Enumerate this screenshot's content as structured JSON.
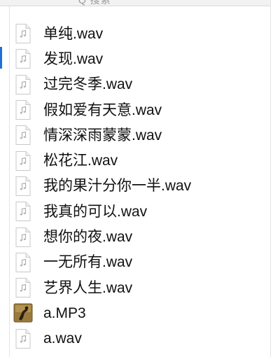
{
  "search": {
    "hint": "Q 搜索"
  },
  "files": [
    {
      "name": "单纯.wav",
      "icon": "audio-file-icon"
    },
    {
      "name": "发现.wav",
      "icon": "audio-file-icon"
    },
    {
      "name": "过完冬季.wav",
      "icon": "audio-file-icon"
    },
    {
      "name": "假如爱有天意.wav",
      "icon": "audio-file-icon"
    },
    {
      "name": "情深深雨蒙蒙.wav",
      "icon": "audio-file-icon"
    },
    {
      "name": "松花江.wav",
      "icon": "audio-file-icon"
    },
    {
      "name": "我的果汁分你一半.wav",
      "icon": "audio-file-icon"
    },
    {
      "name": "我真的可以.wav",
      "icon": "audio-file-icon"
    },
    {
      "name": "想你的夜.wav",
      "icon": "audio-file-icon"
    },
    {
      "name": "一无所有.wav",
      "icon": "audio-file-icon"
    },
    {
      "name": "艺界人生.wav",
      "icon": "audio-file-icon"
    },
    {
      "name": "a.MP3",
      "icon": "album-artwork-icon"
    },
    {
      "name": "a.wav",
      "icon": "audio-file-icon"
    }
  ],
  "colors": {
    "selection": "#1f6fd6",
    "text": "#111111",
    "icon_border": "#c8c8c8",
    "icon_glyph": "#b0b0b0",
    "artwork_bg": "#9a7a3c"
  }
}
